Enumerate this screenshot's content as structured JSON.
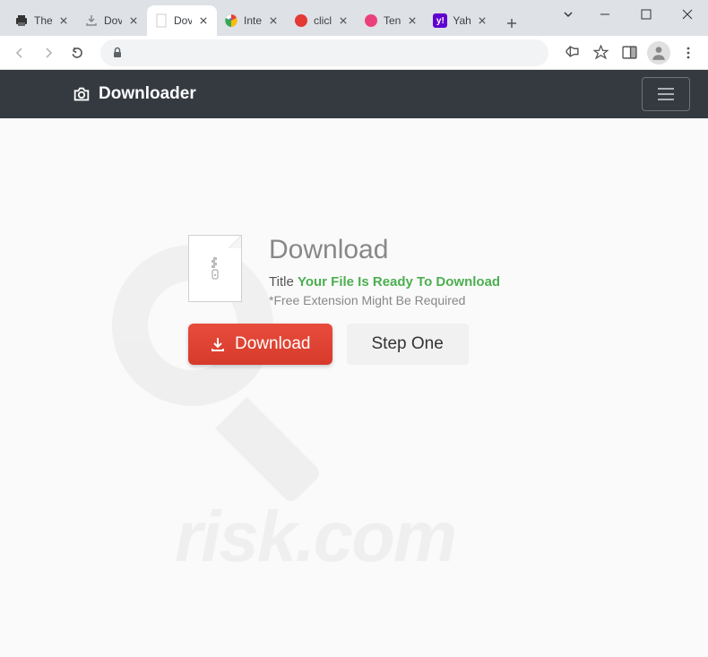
{
  "window": {
    "tabs": [
      {
        "title": "The",
        "favicon": "printer"
      },
      {
        "title": "Dov",
        "favicon": "download"
      },
      {
        "title": "Dov",
        "favicon": "blank",
        "active": true
      },
      {
        "title": "Inte",
        "favicon": "chrome"
      },
      {
        "title": "clicl",
        "favicon": "red"
      },
      {
        "title": "Ten",
        "favicon": "pink"
      },
      {
        "title": "Yah",
        "favicon": "yahoo"
      }
    ]
  },
  "page": {
    "navbar": {
      "brand": "Downloader"
    },
    "card": {
      "heading": "Download",
      "title_label": "Title",
      "title_text": "Your File Is Ready To Download",
      "note": "*Free Extension Might Be Required",
      "download_button": "Download",
      "step_button": "Step One"
    }
  }
}
